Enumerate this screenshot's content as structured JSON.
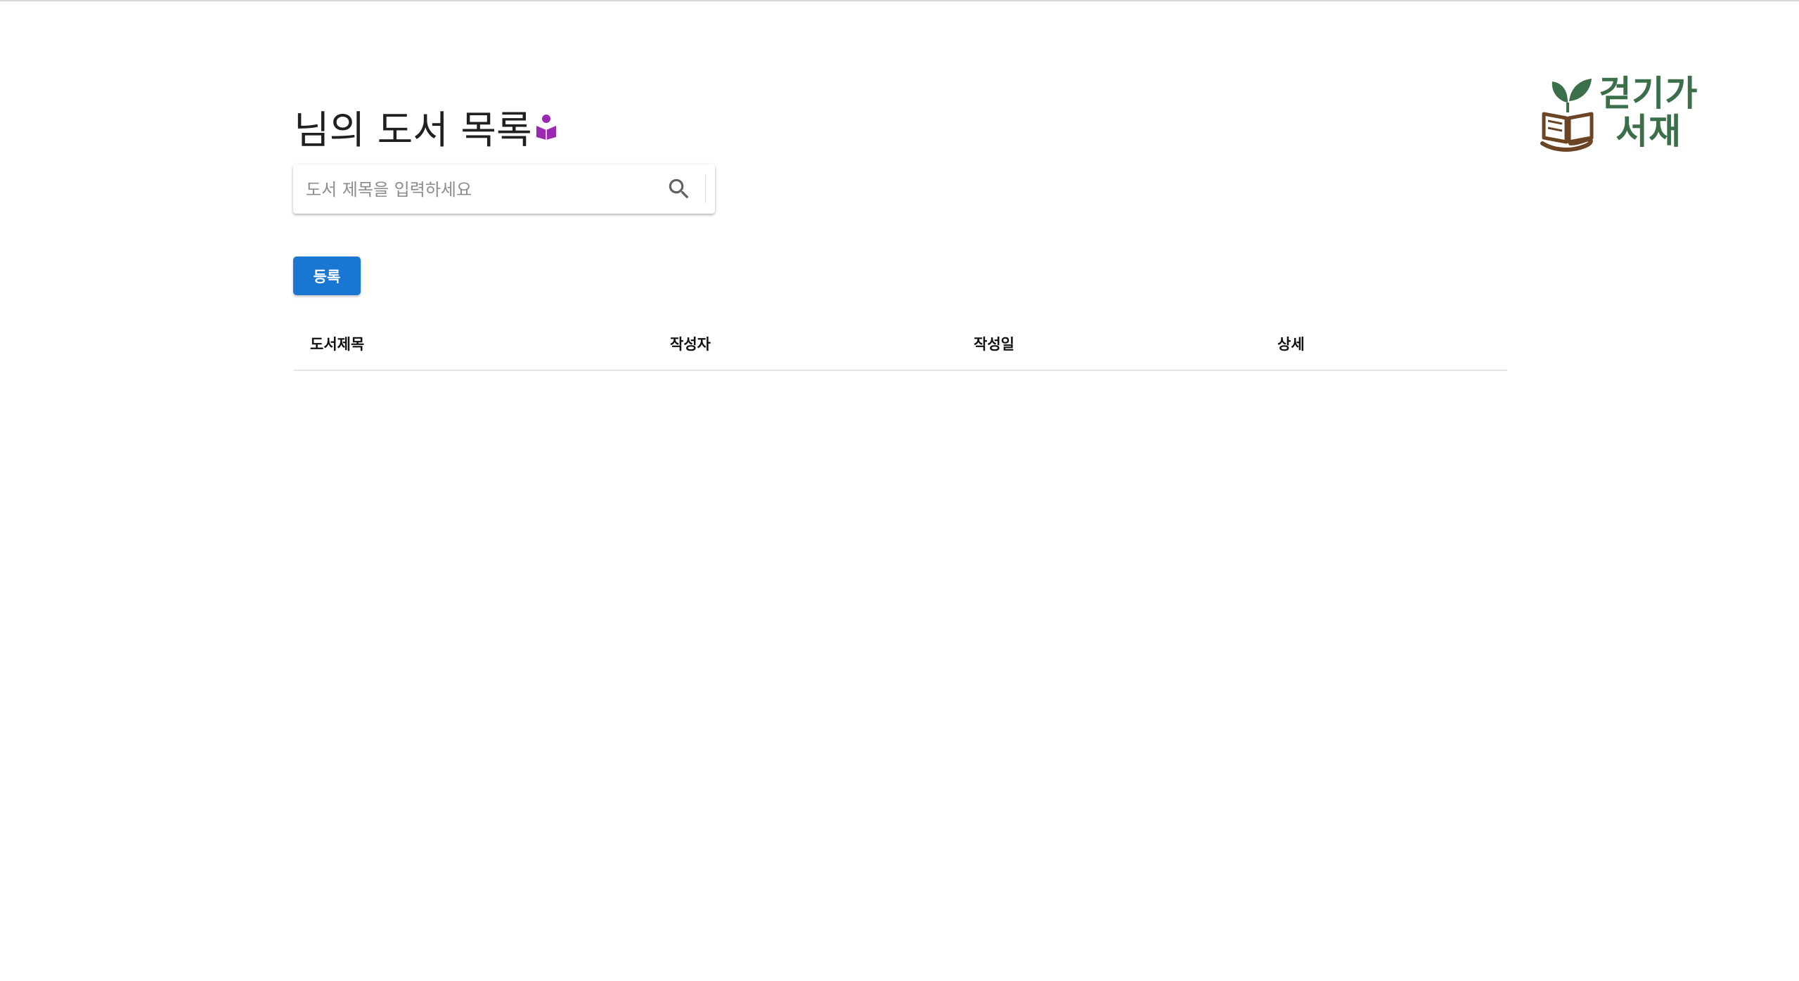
{
  "logo": {
    "line1": "걷기가",
    "line2": "서재",
    "icon": "book-sprout-icon",
    "text_color": "#3b6f4a"
  },
  "header": {
    "title": "님의 도서 목록",
    "title_icon": "reading-book-icon",
    "title_icon_color": "#9c27b0"
  },
  "search": {
    "placeholder": "도서 제목을 입력하세요",
    "value": "",
    "icon": "search-icon"
  },
  "actions": {
    "register_label": "등록",
    "register_color": "#1976d2"
  },
  "table": {
    "columns": [
      "도서제목",
      "작성자",
      "작성일",
      "상세"
    ],
    "rows": []
  }
}
